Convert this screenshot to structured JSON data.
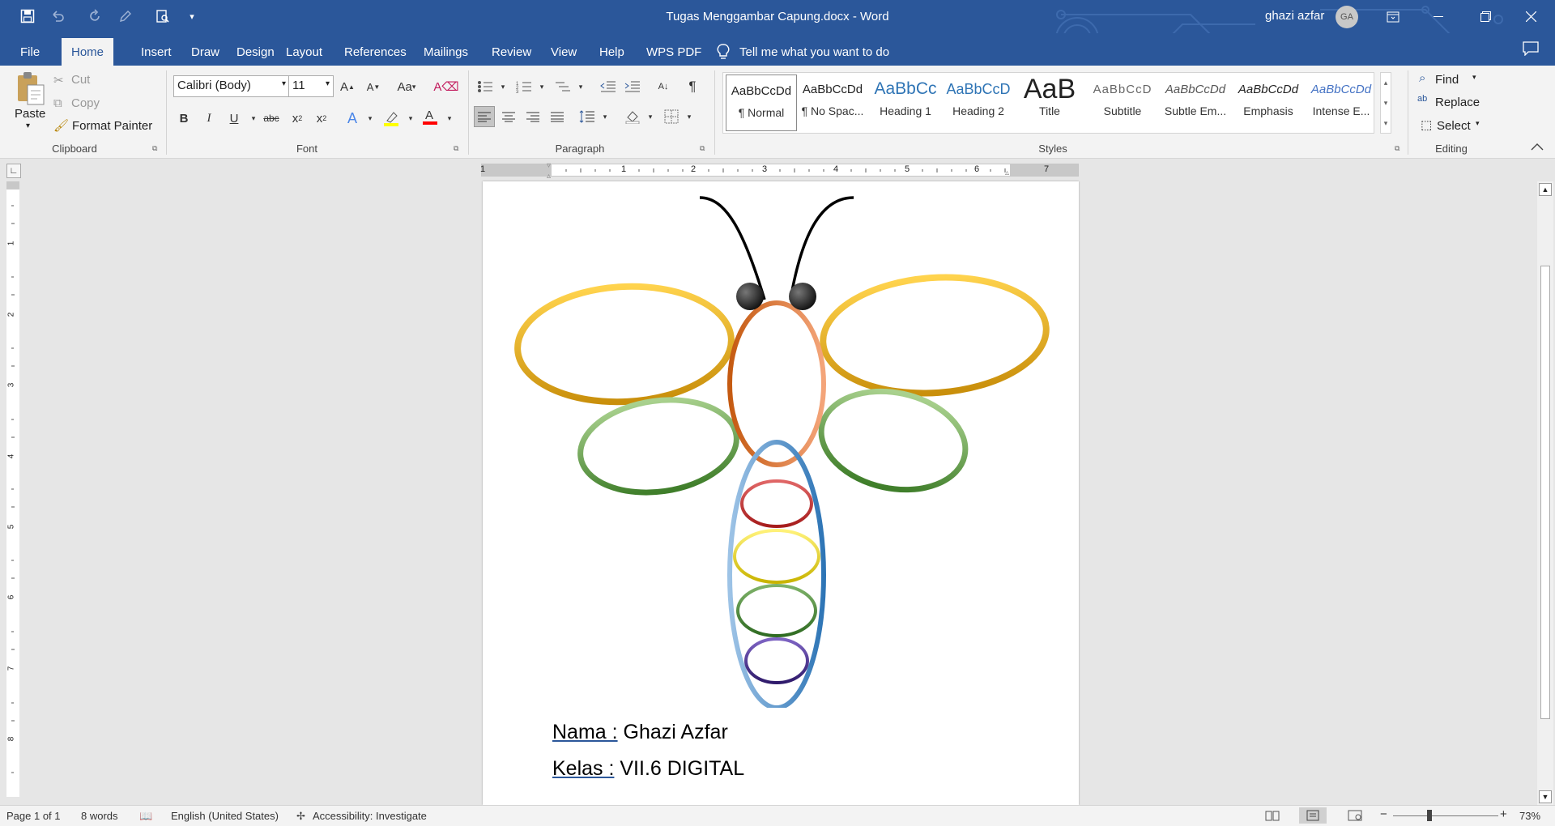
{
  "titlebar": {
    "document_title": "Tugas Menggambar Capung.docx  -  Word",
    "user_name": "ghazi azfar",
    "user_initials": "GA"
  },
  "tabs": [
    "File",
    "Home",
    "Insert",
    "Draw",
    "Design",
    "Layout",
    "References",
    "Mailings",
    "Review",
    "View",
    "Help",
    "WPS PDF"
  ],
  "active_tab": "Home",
  "tell_me": "Tell me what you want to do",
  "clipboard": {
    "paste": "Paste",
    "cut": "Cut",
    "copy": "Copy",
    "format_painter": "Format Painter",
    "label": "Clipboard"
  },
  "font": {
    "family": "Calibri (Body)",
    "size": "11",
    "case_label": "Aa",
    "bold": "B",
    "italic": "I",
    "underline": "U",
    "strike": "abc",
    "label": "Font"
  },
  "paragraph": {
    "label": "Paragraph"
  },
  "styles": {
    "label": "Styles",
    "items": [
      {
        "preview": "AaBbCcDd",
        "name": "¶ Normal"
      },
      {
        "preview": "AaBbCcDd",
        "name": "¶ No Spac..."
      },
      {
        "preview": "AaBbCc",
        "name": "Heading 1"
      },
      {
        "preview": "AaBbCcD",
        "name": "Heading 2"
      },
      {
        "preview": "AaB",
        "name": "Title"
      },
      {
        "preview": "AaBbCcD",
        "name": "Subtitle"
      },
      {
        "preview": "AaBbCcDd",
        "name": "Subtle Em..."
      },
      {
        "preview": "AaBbCcDd",
        "name": "Emphasis"
      },
      {
        "preview": "AaBbCcDd",
        "name": "Intense E..."
      }
    ]
  },
  "editing": {
    "find": "Find",
    "replace": "Replace",
    "select": "Select",
    "label": "Editing"
  },
  "ruler_numbers": [
    "1",
    "1",
    "2",
    "3",
    "4",
    "5",
    "6",
    "7"
  ],
  "vruler_numbers": [
    "1",
    "2",
    "3",
    "4",
    "5",
    "6",
    "7",
    "8"
  ],
  "document": {
    "nama_label": "Nama :",
    "nama_value": " Ghazi Azfar",
    "kelas_label": "Kelas :",
    "kelas_value": " VII.6 DIGITAL"
  },
  "statusbar": {
    "page": "Page 1 of 1",
    "words": "8 words",
    "language": "English (United States)",
    "accessibility": "Accessibility: Investigate",
    "zoom": "73%"
  },
  "colors": {
    "brand": "#2b579a",
    "wing_upper": "#f4b521",
    "wing_lower": "#6aa84f",
    "thorax": "#d9712b",
    "abdomen": "#5b9bd5",
    "ring1": "#c0272d",
    "ring2": "#e8d31a",
    "ring3": "#4a8a3a",
    "ring4": "#4b2e8c",
    "eye": "#2a2a2a"
  }
}
